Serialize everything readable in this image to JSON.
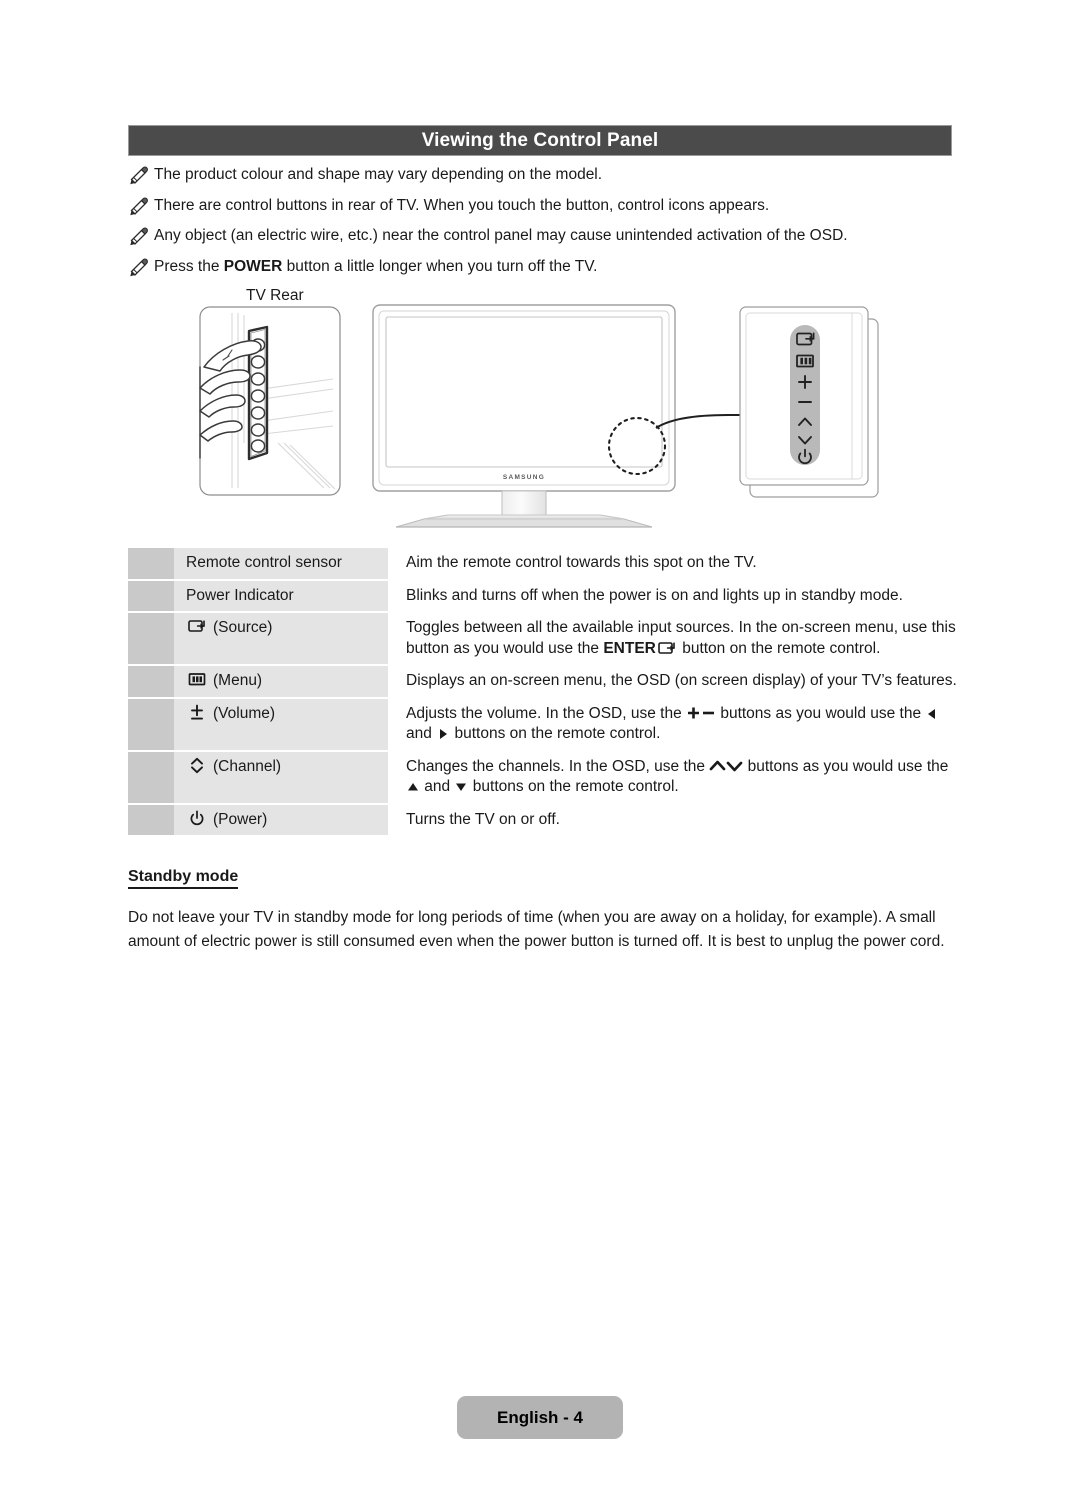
{
  "header": {
    "title": "Viewing the Control Panel",
    "bar_color": "#4b4b4b"
  },
  "notes": [
    {
      "icon": "pencil-note-icon",
      "text": "The product colour and shape may vary depending on the model."
    },
    {
      "icon": "pencil-note-icon",
      "text": "There are control buttons in rear of TV. When you touch the button, control icons appears."
    },
    {
      "icon": "pencil-note-icon",
      "text": "Any object (an electric wire, etc.) near the control panel may cause unintended activation of the OSD."
    },
    {
      "icon": "pencil-note-icon",
      "text_pre": "Press the ",
      "emphasis": "POWER",
      "text_post": " button a little longer when you turn off the TV."
    }
  ],
  "illustration": {
    "tv_rear_label": "TV Rear",
    "tv_brand_logo": "SAMSUNG",
    "rear_button_count": 7,
    "control_strip_icons": [
      "source-icon",
      "menu-icon",
      "volume-up-icon",
      "volume-down-icon",
      "channel-up-icon",
      "channel-down-icon",
      "power-icon"
    ]
  },
  "table": {
    "rows": [
      {
        "icon": "",
        "label": "Remote control sensor",
        "desc_parts": [
          {
            "t": "text",
            "v": "Aim the remote control towards this spot on the TV."
          }
        ]
      },
      {
        "icon": "",
        "label": "Power Indicator",
        "desc_parts": [
          {
            "t": "text",
            "v": "Blinks and turns off when the power is on and lights up in standby mode."
          }
        ]
      },
      {
        "icon": "source-icon",
        "label": "(Source)",
        "desc_parts": [
          {
            "t": "text",
            "v": "Toggles between all the available input sources. In the on-screen menu, use this button as you would use the "
          },
          {
            "t": "bold",
            "v": "ENTER"
          },
          {
            "t": "icon",
            "v": "source-icon"
          },
          {
            "t": "text",
            "v": " button on the remote control."
          }
        ]
      },
      {
        "icon": "menu-icon",
        "label": "(Menu)",
        "desc_parts": [
          {
            "t": "text",
            "v": "Displays an on-screen menu, the OSD (on screen display) of your TV’s features."
          }
        ]
      },
      {
        "icon": "volume-icon",
        "label": "(Volume)",
        "desc_parts": [
          {
            "t": "text",
            "v": "Adjusts the volume. In the OSD, use the "
          },
          {
            "t": "sym",
            "v": "✚➖"
          },
          {
            "t": "text",
            "v": " buttons as you would use the "
          },
          {
            "t": "sym",
            "v": "◀"
          },
          {
            "t": "text",
            "v": " and "
          },
          {
            "t": "sym",
            "v": "▶"
          },
          {
            "t": "text",
            "v": " buttons on the remote control."
          }
        ]
      },
      {
        "icon": "channel-icon",
        "label": "(Channel)",
        "desc_parts": [
          {
            "t": "text",
            "v": "Changes the channels. In the OSD, use the "
          },
          {
            "t": "sym",
            "v": "∧∨"
          },
          {
            "t": "text",
            "v": " buttons as you would use the "
          },
          {
            "t": "sym",
            "v": "▲"
          },
          {
            "t": "text",
            "v": " and "
          },
          {
            "t": "sym",
            "v": "▼"
          },
          {
            "t": "text",
            "v": " buttons on the remote control."
          }
        ]
      },
      {
        "icon": "power-icon",
        "label": "(Power)",
        "desc_parts": [
          {
            "t": "text",
            "v": "Turns the TV on or off."
          }
        ]
      }
    ]
  },
  "standby": {
    "title": "Standby mode",
    "body": "Do not leave your TV in standby mode for long periods of time (when you are away on a holiday, for example). A small amount of electric power is still consumed even when the power button is turned off. It is best to unplug the power cord."
  },
  "footer": {
    "label": "English - 4"
  }
}
